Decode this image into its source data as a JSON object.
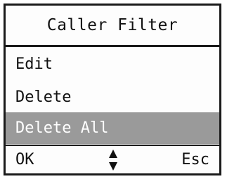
{
  "screen": {
    "title": "Caller Filter",
    "menu_items": [
      {
        "label": "Edit",
        "selected": false
      },
      {
        "label": "Delete",
        "selected": false
      },
      {
        "label": "Delete All",
        "selected": true
      }
    ],
    "softkeys": {
      "left": "OK",
      "right": "Esc"
    },
    "nav_icon": "up-down-arrows-icon",
    "colors": {
      "highlight": "#9a9a9a",
      "highlight_text": "#ffffff",
      "border": "#1a1a1a"
    }
  }
}
